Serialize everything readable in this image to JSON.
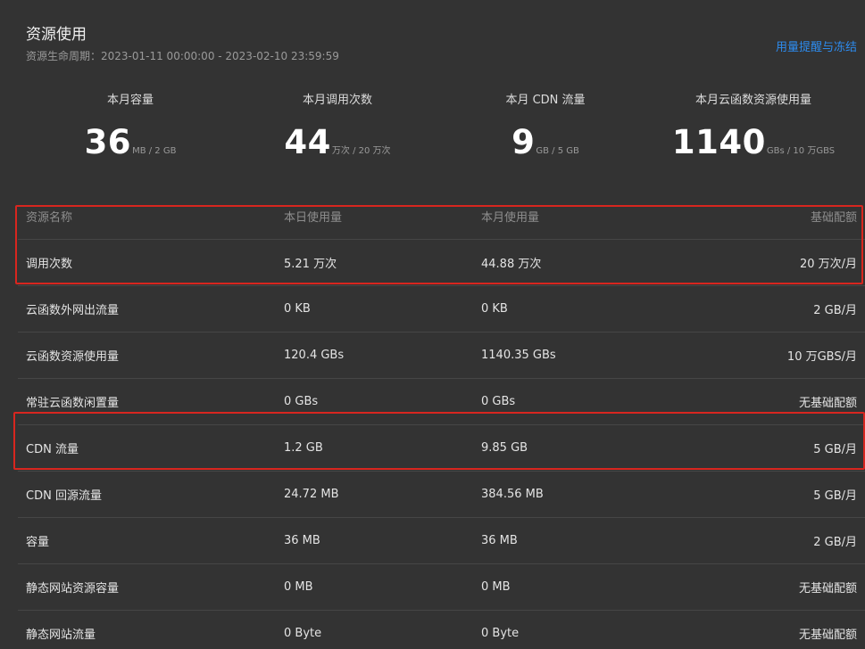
{
  "header": {
    "title": "资源使用",
    "lifecycle": "资源生命周期：2023-01-11 00:00:00 - 2023-02-10 23:59:59",
    "link": "用量提醒与冻结"
  },
  "stats": [
    {
      "label": "本月容量",
      "value": "36",
      "unit": "MB / 2 GB"
    },
    {
      "label": "本月调用次数",
      "value": "44",
      "unit": "万次 / 20 万次"
    },
    {
      "label": "本月 CDN 流量",
      "value": "9",
      "unit": "GB / 5 GB"
    },
    {
      "label": "本月云函数资源使用量",
      "value": "1140",
      "unit": "GBs / 10 万GBS"
    }
  ],
  "table": {
    "columns": [
      "资源名称",
      "本日使用量",
      "本月使用量",
      "基础配额"
    ],
    "rows": [
      [
        "调用次数",
        "5.21 万次",
        "44.88 万次",
        "20 万次/月"
      ],
      [
        "云函数外网出流量",
        "0 KB",
        "0 KB",
        "2 GB/月"
      ],
      [
        "云函数资源使用量",
        "120.4 GBs",
        "1140.35 GBs",
        "10 万GBS/月"
      ],
      [
        "常驻云函数闲置量",
        "0 GBs",
        "0 GBs",
        "无基础配额"
      ],
      [
        "CDN 流量",
        "1.2 GB",
        "9.85 GB",
        "5 GB/月"
      ],
      [
        "CDN 回源流量",
        "24.72 MB",
        "384.56 MB",
        "5 GB/月"
      ],
      [
        "容量",
        "36 MB",
        "36 MB",
        "2 GB/月"
      ],
      [
        "静态网站资源容量",
        "0 MB",
        "0 MB",
        "无基础配额"
      ],
      [
        "静态网站流量",
        "0 Byte",
        "0 Byte",
        "无基础配额"
      ]
    ]
  },
  "colors": {
    "background": "#333333",
    "link": "#2d8cf0",
    "highlight": "#d8261f"
  }
}
